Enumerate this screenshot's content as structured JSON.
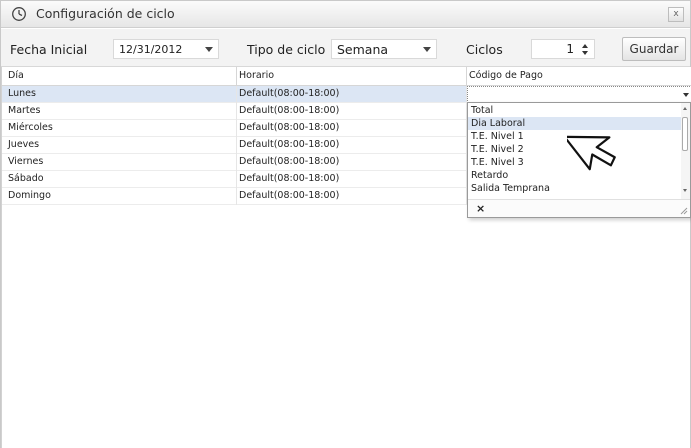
{
  "window": {
    "title": "Configuración de ciclo",
    "close_label": "x"
  },
  "toolbar": {
    "fecha_label": "Fecha Inicial",
    "fecha_value": "12/31/2012",
    "tipo_label": "Tipo de ciclo",
    "tipo_value": "Semana",
    "ciclos_label": "Ciclos",
    "ciclos_value": "1",
    "save_label": "Guardar"
  },
  "grid": {
    "columns": [
      "Día",
      "Horario",
      "Código de Pago"
    ],
    "rows": [
      {
        "dia": "Lunes",
        "horario": "Default(08:00-18:00)",
        "codigo": ""
      },
      {
        "dia": "Martes",
        "horario": "Default(08:00-18:00)",
        "codigo": ""
      },
      {
        "dia": "Miércoles",
        "horario": "Default(08:00-18:00)",
        "codigo": ""
      },
      {
        "dia": "Jueves",
        "horario": "Default(08:00-18:00)",
        "codigo": ""
      },
      {
        "dia": "Viernes",
        "horario": "Default(08:00-18:00)",
        "codigo": ""
      },
      {
        "dia": "Sábado",
        "horario": "Default(08:00-18:00)",
        "codigo": ""
      },
      {
        "dia": "Domingo",
        "horario": "Default(08:00-18:00)",
        "codigo": ""
      }
    ],
    "selected_row": 0
  },
  "dropdown": {
    "options": [
      "Total",
      "Dia Laboral",
      "T.E. Nivel 1",
      "T.E. Nivel 2",
      "T.E. Nivel 3",
      "Retardo",
      "Salida Temprana"
    ],
    "hovered_index": 1,
    "clear_symbol": "×"
  },
  "icons": {
    "title": "clock-icon",
    "close": "close-icon",
    "fecha_dropdown": "chevron-down-icon",
    "tipo_dropdown": "chevron-down-icon",
    "spinner": "spinner-arrows-icon",
    "editor_dropdown": "chevron-down-icon",
    "clear": "clear-icon",
    "resize": "resize-grip-icon",
    "cursor": "cursor-arrow-icon"
  },
  "colors": {
    "selection": "#dce6f4",
    "toolbar_bg": "#f3f3f3",
    "border": "#d2d2d2"
  }
}
